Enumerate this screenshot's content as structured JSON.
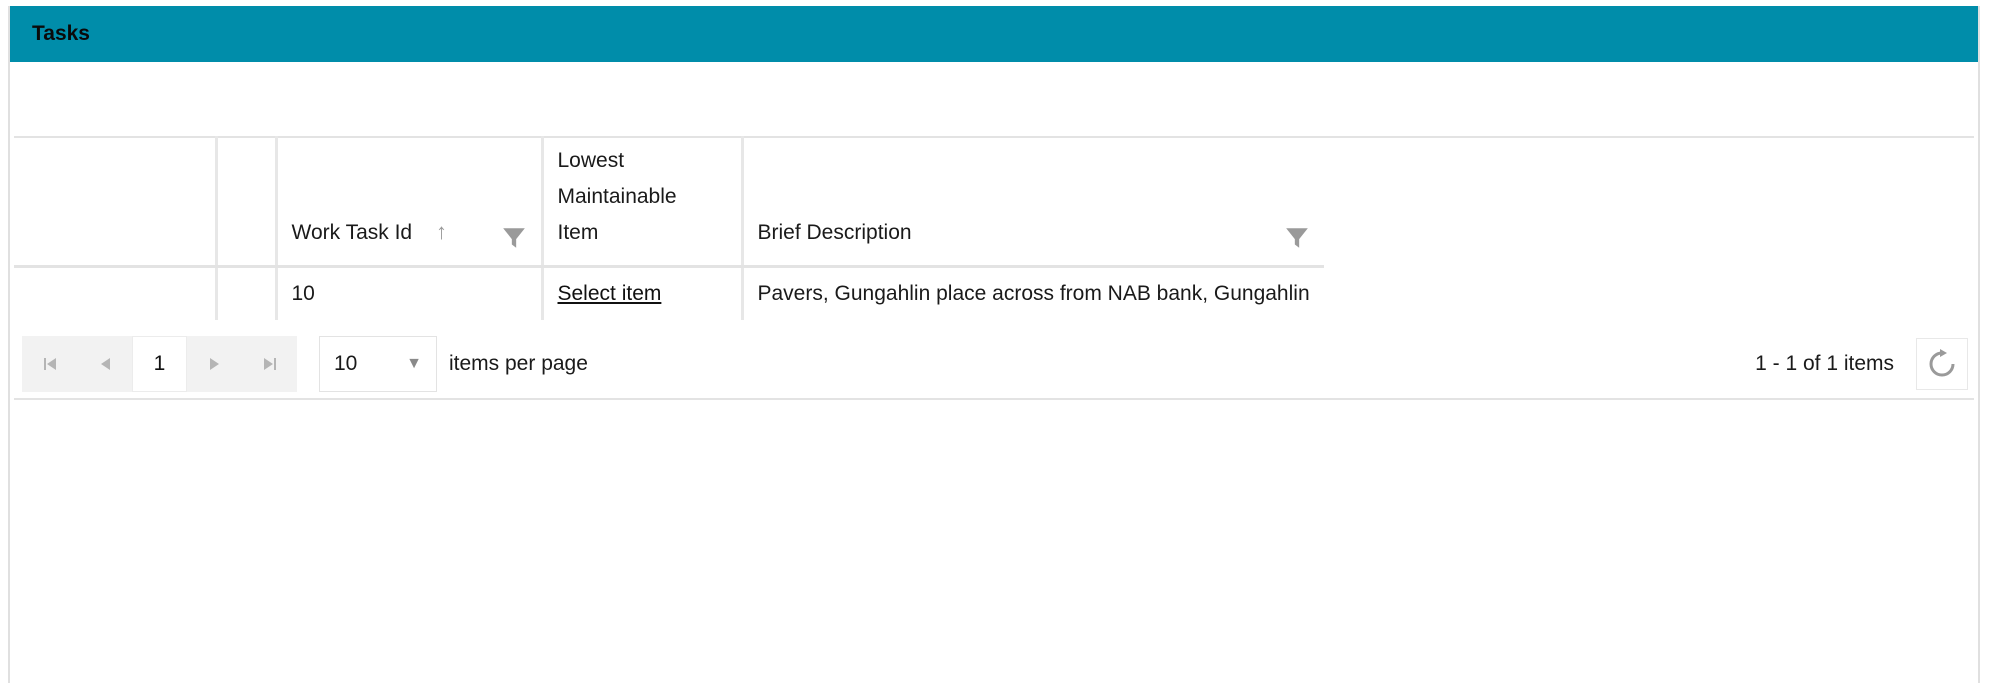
{
  "panel": {
    "title": "Tasks"
  },
  "grid": {
    "columns": [
      {
        "label": ""
      },
      {
        "label": ""
      },
      {
        "label": "Work Task Id"
      },
      {
        "label": "Lowest Maintainable Item"
      },
      {
        "label": "Brief Description"
      }
    ],
    "rows": [
      {
        "work_task_id": "10",
        "lowest_item": "Select item",
        "brief_description": "Pavers, Gungahlin place across from NAB bank, Gungahlin"
      }
    ]
  },
  "pager": {
    "current_page": "1",
    "page_size": "10",
    "per_page_label": "items per page",
    "info": "1 - 1 of 1 items"
  },
  "colors": {
    "header_bg": "#008daa"
  },
  "icons": [
    "first-page-icon",
    "prev-page-icon",
    "next-page-icon",
    "last-page-icon",
    "sort-ascending-icon",
    "filter-icon",
    "dropdown-caret-icon",
    "refresh-icon"
  ]
}
